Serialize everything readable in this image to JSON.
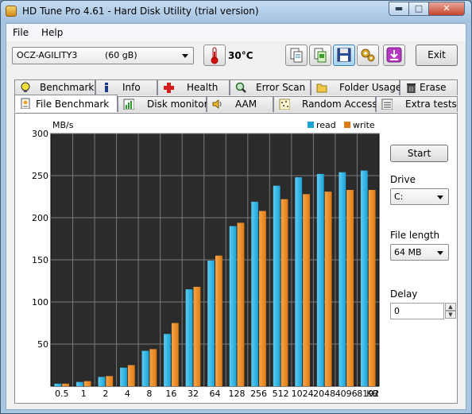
{
  "window": {
    "title": "HD Tune Pro 4.61 - Hard Disk Utility (trial version)"
  },
  "menu": {
    "file": "File",
    "help": "Help"
  },
  "toolbar": {
    "drive_name": "OCZ-AGILITY3",
    "drive_capacity": "(60 gB)",
    "temperature": "30°C",
    "exit_label": "Exit"
  },
  "tabs_top": [
    "Benchmark",
    "Info",
    "Health",
    "Error Scan",
    "Folder Usage",
    "Erase"
  ],
  "tabs_bottom": [
    "File Benchmark",
    "Disk monitor",
    "AAM",
    "Random Access",
    "Extra tests"
  ],
  "panel": {
    "start_label": "Start",
    "drive_label": "Drive",
    "drive_value": "C:",
    "file_length_label": "File length",
    "file_length_value": "64 MB",
    "delay_label": "Delay",
    "delay_value": "0"
  },
  "colors": {
    "read": "#1ba3d6",
    "write": "#e07b12",
    "background": "#2b2b2b"
  },
  "chart_data": {
    "type": "bar",
    "ylabel": "MB/s",
    "xunit": "KB",
    "ylim": [
      0,
      300
    ],
    "yticks": [
      50,
      100,
      150,
      200,
      250,
      300
    ],
    "categories": [
      "0.5",
      "1",
      "2",
      "4",
      "8",
      "16",
      "32",
      "64",
      "128",
      "256",
      "512",
      "1024",
      "2048",
      "4096",
      "8192"
    ],
    "series": [
      {
        "name": "read",
        "values": [
          3,
          5,
          11,
          22,
          42,
          62,
          115,
          149,
          190,
          219,
          238,
          248,
          252,
          254,
          256
        ]
      },
      {
        "name": "write",
        "values": [
          3,
          6,
          12,
          25,
          44,
          75,
          118,
          155,
          194,
          208,
          222,
          228,
          231,
          233,
          233
        ]
      }
    ],
    "legend": "top-right",
    "grid": true
  }
}
